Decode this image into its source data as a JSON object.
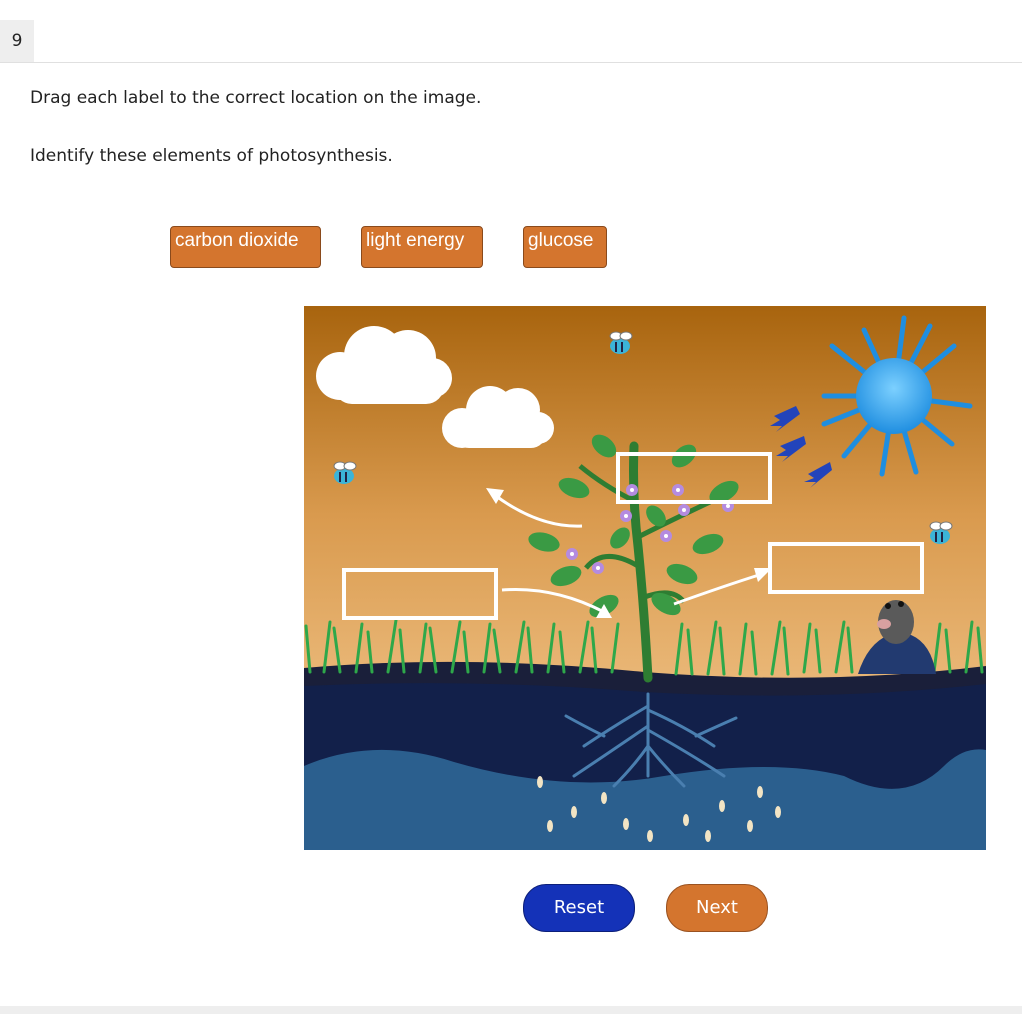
{
  "question": {
    "number": "9",
    "instruction": "Drag each label to the correct location on the image.",
    "prompt": "Identify these elements of photosynthesis."
  },
  "labels": [
    {
      "text": "carbon dioxide"
    },
    {
      "text": "light energy"
    },
    {
      "text": "glucose"
    }
  ],
  "buttons": {
    "reset": "Reset",
    "next": "Next"
  },
  "colors": {
    "label_bg": "#d4752e",
    "reset_bg": "#1432b8",
    "next_bg": "#d4752e",
    "sky_top": "#b06a10",
    "sky_bottom": "#e4aa62",
    "sun": "#2b9be8",
    "soil": "#12204a",
    "water": "#2b5f8e"
  },
  "icons": [
    "sun-icon",
    "cloud-icon",
    "bee-icon",
    "mole-icon",
    "plant-icon",
    "arrow-icon",
    "water-drop-icon"
  ]
}
